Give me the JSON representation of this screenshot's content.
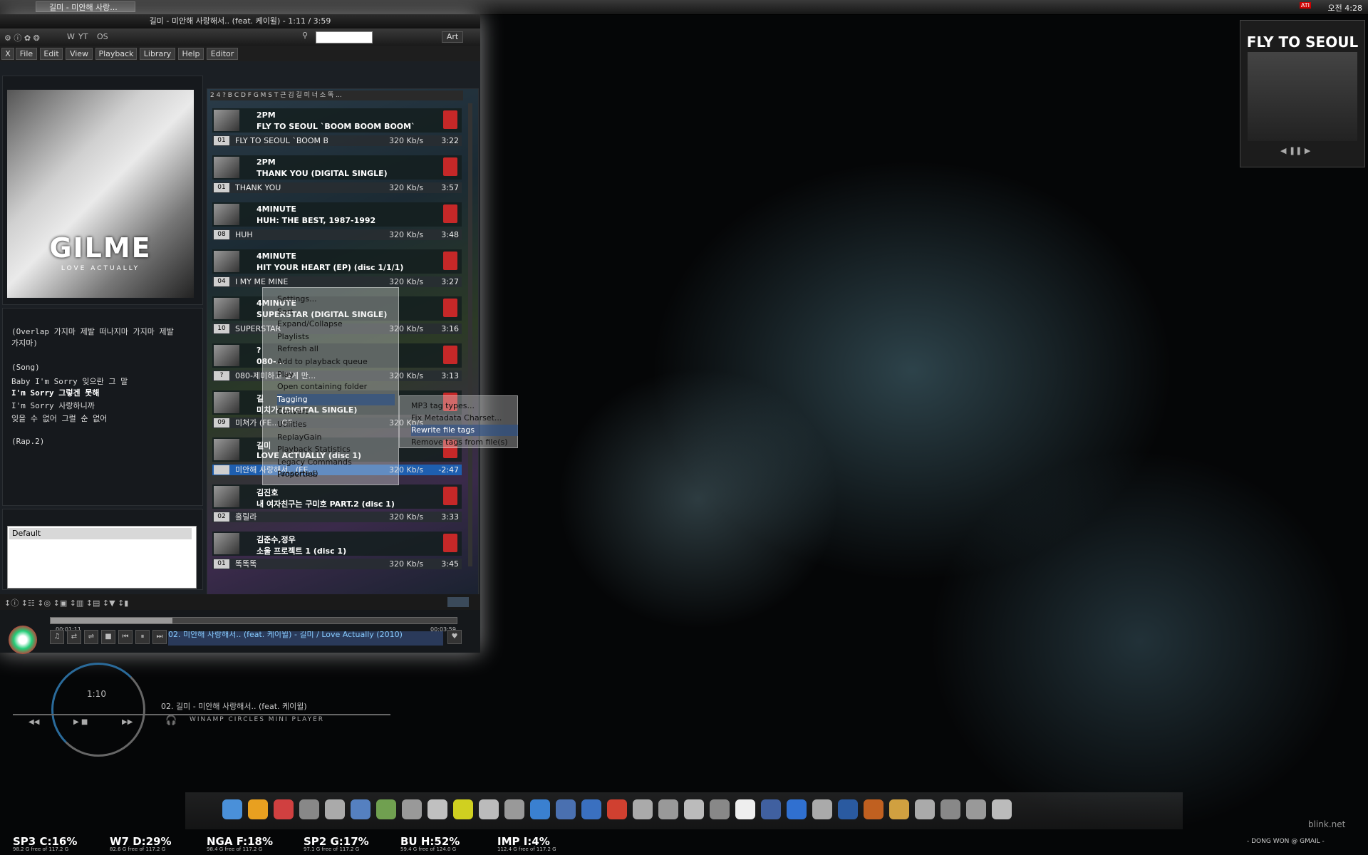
{
  "taskbar": {
    "task_label": "길미 - 미안해 사랑...",
    "clock": "오전 4:28",
    "ati": "ATI"
  },
  "winamp": {
    "title": "길미 - 미안해 사랑해서.. (feat. 케이윌) - 1:11 / 3:59",
    "toolbar_icons": [
      "W",
      "YT",
      "OS"
    ],
    "art_label": "Art",
    "menu": [
      "X",
      "File",
      "Edit",
      "View",
      "Playback",
      "Library",
      "Help",
      "Editor"
    ],
    "album_art_logo": "GILME",
    "album_art_sub": "LOVE ACTUALLY",
    "lyrics": [
      "(Overlap 가지마 제발 떠나지마 가지마 제발",
      "가지마)",
      "",
      "(Song)",
      "Baby I'm Sorry 잊으란 그 말",
      "I'm Sorry 그렇겐 못해",
      "I'm Sorry 사랑하니까",
      "잊을 수 없어 그럴 순 없어",
      "",
      "(Rap.2)"
    ],
    "default_list": [
      "Default"
    ],
    "alphabar": "2 4 ? B C D F G M S T 근 김 길 미 너 소 똑 ...",
    "playlist": [
      {
        "artist": "2PM",
        "album": "FLY TO SEOUL `BOOM BOOM BOOM`",
        "no": "01",
        "title": "FLY TO SEOUL `BOOM B...",
        "bitrate": "320 Kb/s",
        "length": "3:22"
      },
      {
        "artist": "2PM",
        "album": "THANK YOU (DIGITAL SINGLE)",
        "no": "01",
        "title": "THANK YOU",
        "bitrate": "320 Kb/s",
        "length": "3:57"
      },
      {
        "artist": "4MINUTE",
        "album": "HUH: THE BEST, 1987-1992",
        "no": "08",
        "title": "HUH",
        "bitrate": "320 Kb/s",
        "length": "3:48"
      },
      {
        "artist": "4MINUTE",
        "album": "HIT YOUR HEART (EP) (disc 1/1/1)",
        "no": "04",
        "title": "I MY ME MINE",
        "bitrate": "320 Kb/s",
        "length": "3:27"
      },
      {
        "artist": "4MINUTE",
        "album": "SUPERSTAR (DIGITAL SINGLE)",
        "no": "10",
        "title": "SUPERSTAR",
        "bitrate": "320 Kb/s",
        "length": "3:16"
      },
      {
        "artist": "?",
        "album": "080-...",
        "no": "?",
        "title": "080-제미하고 싶게 만...",
        "bitrate": "320 Kb/s",
        "length": "3:13"
      },
      {
        "artist": "길",
        "album": "미치가 (DIGITAL SINGLE)",
        "no": "09",
        "title": "미쳐가 (FE... OF ...",
        "bitrate": "320 Kb/s",
        "length": ""
      },
      {
        "artist": "길미",
        "album": "LOVE ACTUALLY (disc 1)",
        "no": "",
        "title": "미안해 사랑해서.. (FE...",
        "bitrate": "320 Kb/s",
        "length": "-2:47"
      },
      {
        "artist": "김진호",
        "album": "내 여자친구는 구미호 PART.2 (disc 1)",
        "no": "02",
        "title": "홀릴라",
        "bitrate": "320 Kb/s",
        "length": "3:33"
      },
      {
        "artist": "김준수,정우",
        "album": "소울 프로젝트 1 (disc 1)",
        "no": "01",
        "title": "똑똑똑",
        "bitrate": "320 Kb/s",
        "length": "3:45"
      }
    ],
    "transport": {
      "elapsed": "00:01:11",
      "total": "00:03:59",
      "progress": 0.3,
      "ticker": "02. 미안해 사랑해서.. (feat. 케이윌) - 길미 / Love Actually (2010)"
    }
  },
  "context_menu": {
    "items": [
      "Settings...",
      "Sort",
      "Expand/Collapse",
      "Playlists",
      "Refresh all",
      "Add to playback queue",
      "Play",
      "Open containing folder",
      "Tagging",
      "Convert",
      "Utilities",
      "ReplayGain",
      "Playback Statistics",
      "Legacy Commands (unsorted)",
      "Properties"
    ],
    "submenu": [
      "MP3 tag types...",
      "Fix Metadata Charset...",
      "Rewrite file tags",
      "Remove tags from file(s)"
    ]
  },
  "widget": {
    "title": "FLY TO SEOUL"
  },
  "mini_player": {
    "time": "1:10",
    "track": "02. 길미 - 미안해 사랑해서.. (feat. 케이윌)",
    "label": "WINAMP CIRCLES MINI PLAYER"
  },
  "drives": [
    {
      "label": "SP3 C:16%",
      "sub": "98.2 G free of 117.2 G"
    },
    {
      "label": "W7 D:29%",
      "sub": "82.6 G free of 117.2 G"
    },
    {
      "label": "NGA F:18%",
      "sub": "98.4 G free of 117.2 G"
    },
    {
      "label": "SP2 G:17%",
      "sub": "97.1 G free of 117.2 G"
    },
    {
      "label": "BU H:52%",
      "sub": "59.4 G free of 124.0 G"
    },
    {
      "label": "IMP I:4%",
      "sub": "112.4 G free of 117.2 G"
    }
  ],
  "credit": "- DONG WON @ GMAIL -",
  "watermark": "blink.net",
  "colors": {
    "accent": "#1e5fb0",
    "mp3_badge": "#c62828"
  }
}
